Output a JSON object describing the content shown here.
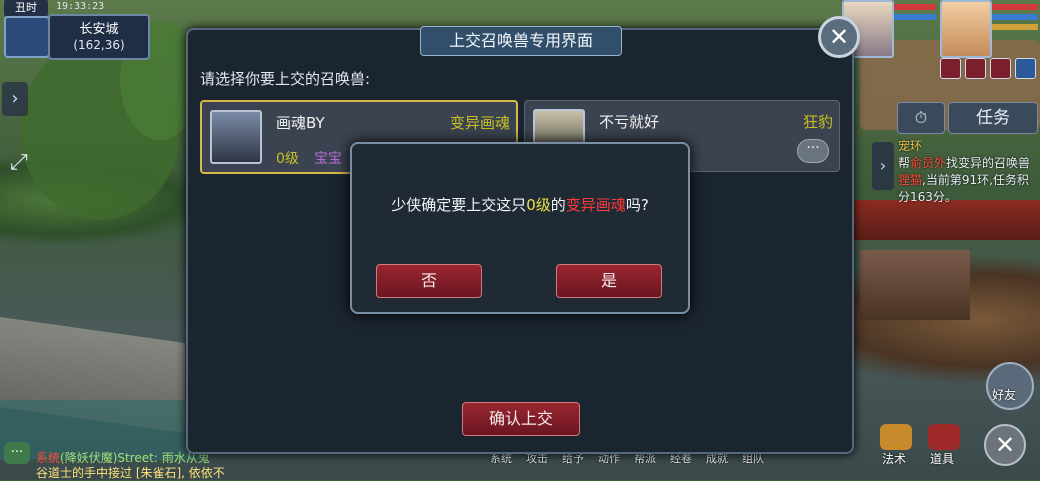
{
  "hud": {
    "shichen": "丑时",
    "time": "19:33:23",
    "location": "长安城",
    "coords": "(162,36)",
    "task_tab": "任务",
    "quest_title": "宠环",
    "quest_pre": "帮",
    "quest_npc": "俞员外",
    "quest_mid": "找变异的召唤兽",
    "quest_pet": "狸猫",
    "quest_post": ",当前第91环,任务积分163分。",
    "friend_label": "好友"
  },
  "bottom_menu": [
    "系统",
    "攻击",
    "给予",
    "动作",
    "帮派",
    "经卷",
    "成就",
    "组队",
    "法术",
    "道具"
  ],
  "chat": {
    "line1_sys": "系统",
    "line1_rest": "(降妖伏魔)Street: 雨水从鬼",
    "line2": "谷道士的手中接过 [朱雀石], 依依不"
  },
  "dialog": {
    "title": "上交召唤兽专用界面",
    "prompt": "请选择你要上交的召唤兽:",
    "confirm_label": "确认上交",
    "pets": [
      {
        "name": "画魂BY",
        "type": "变异画魂",
        "level": "0级",
        "tag": "宝宝"
      },
      {
        "name": "不亏就好",
        "type": "狂豹",
        "more": "···"
      }
    ]
  },
  "popup": {
    "msg_pre": "少侠确定要上交这只",
    "msg_level": "0级",
    "msg_mid": "的",
    "msg_pet": "变异画魂",
    "msg_post": "吗?",
    "no_label": "否",
    "yes_label": "是"
  }
}
